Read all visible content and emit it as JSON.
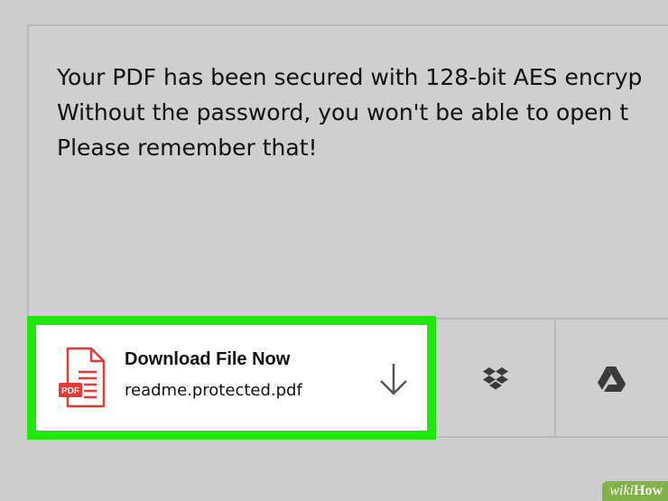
{
  "message": {
    "line1": "Your PDF has been secured with 128-bit AES encryp",
    "line2": "Without the password, you won't be able to open t",
    "line3": "Please remember that!"
  },
  "download": {
    "title": "Download File Now",
    "filename": "readme.protected.pdf",
    "file_badge": "PDF",
    "icon": "pdf-file-icon",
    "action_icon": "download-arrow-icon",
    "highlight_color": "#22e610"
  },
  "cloud_actions": [
    {
      "icon": "dropbox-icon"
    },
    {
      "icon": "google-drive-icon"
    }
  ],
  "watermark": {
    "prefix": "wiki",
    "suffix": "How"
  }
}
